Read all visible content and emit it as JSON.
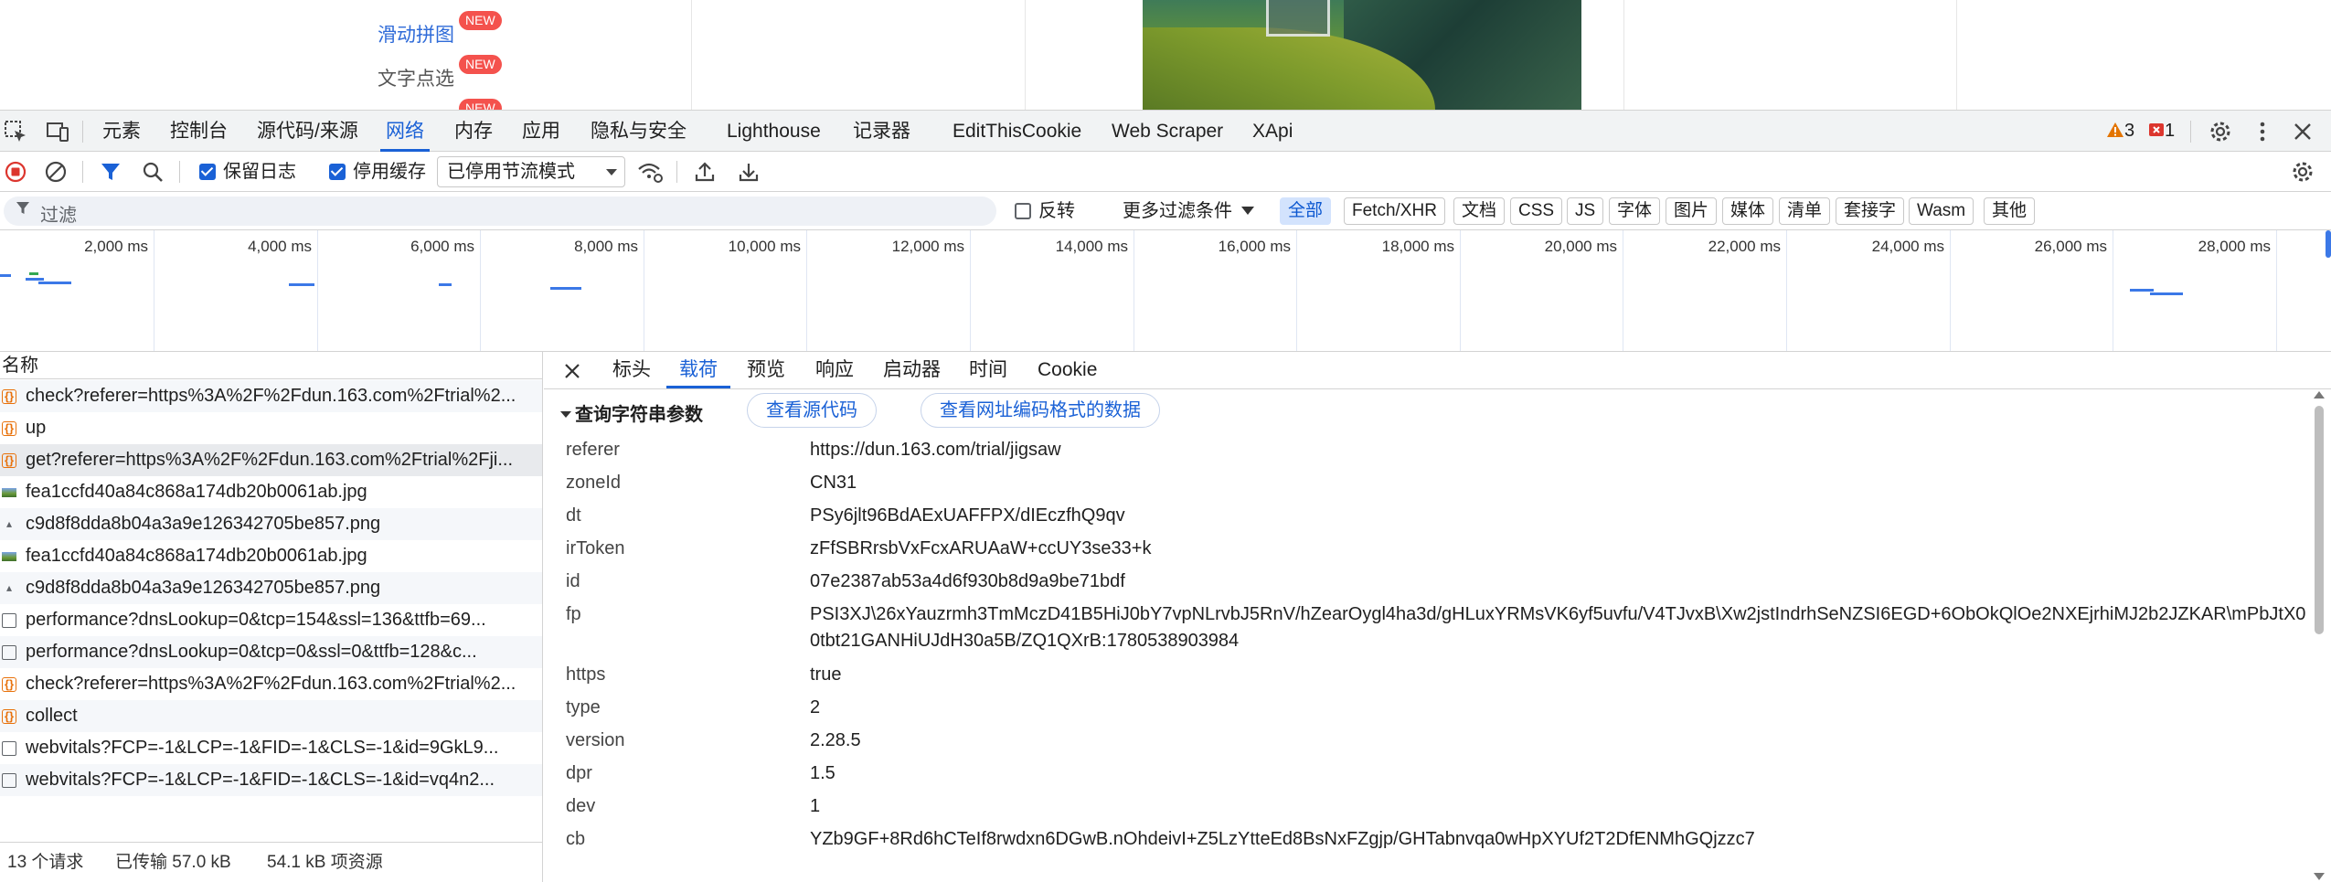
{
  "page": {
    "captcha_links": [
      {
        "label": "滑动拼图",
        "badge": "NEW"
      },
      {
        "label": "文字点选",
        "badge": "NEW"
      },
      {
        "label": "",
        "badge": "NEW"
      }
    ]
  },
  "devtools": {
    "panel_tabs": [
      "元素",
      "控制台",
      "源代码/来源",
      "网络",
      "内存",
      "应用",
      "隐私与安全",
      "Lighthouse",
      "记录器",
      "EditThisCookie",
      "Web Scraper",
      "XApi"
    ],
    "active_panel": "网络",
    "warnings": "3",
    "errors": "1",
    "toolbar": {
      "preserve_log": "保留日志",
      "disable_cache": "停用缓存",
      "throttle": "已停用节流模式"
    },
    "filter": {
      "placeholder": "过滤",
      "invert": "反转",
      "more_filters": "更多过滤条件",
      "types": [
        "全部",
        "Fetch/XHR",
        "文档",
        "CSS",
        "JS",
        "字体",
        "图片",
        "媒体",
        "清单",
        "套接字",
        "Wasm",
        "其他"
      ]
    },
    "overview_ticks": [
      "2,000 ms",
      "4,000 ms",
      "6,000 ms",
      "8,000 ms",
      "10,000 ms",
      "12,000 ms",
      "14,000 ms",
      "16,000 ms",
      "18,000 ms",
      "20,000 ms",
      "22,000 ms",
      "24,000 ms",
      "26,000 ms",
      "28,000 ms"
    ],
    "request_list": {
      "header": "名称",
      "rows": [
        {
          "type": "xhr",
          "name": "check?referer=https%3A%2F%2Fdun.163.com%2Ftrial%2..."
        },
        {
          "type": "xhr",
          "name": "up"
        },
        {
          "type": "xhr",
          "name": "get?referer=https%3A%2F%2Fdun.163.com%2Ftrial%2Fji..."
        },
        {
          "type": "img",
          "name": "fea1ccfd40a84c868a174db20b0061ab.jpg"
        },
        {
          "type": "img2",
          "name": "c9d8f8dda8b04a3a9e126342705be857.png"
        },
        {
          "type": "img",
          "name": "fea1ccfd40a84c868a174db20b0061ab.jpg"
        },
        {
          "type": "img2",
          "name": "c9d8f8dda8b04a3a9e126342705be857.png"
        },
        {
          "type": "doc",
          "name": "performance?dnsLookup=0&tcp=154&ssl=136&ttfb=69..."
        },
        {
          "type": "doc",
          "name": "performance?dnsLookup=0&tcp=0&ssl=0&ttfb=128&c..."
        },
        {
          "type": "xhr",
          "name": "check?referer=https%3A%2F%2Fdun.163.com%2Ftrial%2..."
        },
        {
          "type": "xhr",
          "name": "collect"
        },
        {
          "type": "doc",
          "name": "webvitals?FCP=-1&LCP=-1&FID=-1&CLS=-1&id=9GkL9..."
        },
        {
          "type": "doc",
          "name": "webvitals?FCP=-1&LCP=-1&FID=-1&CLS=-1&id=vq4n2..."
        }
      ],
      "status": {
        "requests": "13 个请求",
        "transferred": "已传输 57.0 kB",
        "resources": "54.1 kB 项资源"
      }
    },
    "detail": {
      "tabs": [
        "标头",
        "载荷",
        "预览",
        "响应",
        "启动器",
        "时间",
        "Cookie"
      ],
      "active_tab": "载荷",
      "section_title": "查询字符串参数",
      "view_source": "查看源代码",
      "view_url_encoded": "查看网址编码格式的数据",
      "params": [
        {
          "key": "referer",
          "value": "https://dun.163.com/trial/jigsaw"
        },
        {
          "key": "zoneId",
          "value": "CN31"
        },
        {
          "key": "dt",
          "value": "PSy6jlt96BdAExUAFFPX/dIEczfhQ9qv"
        },
        {
          "key": "irToken",
          "value": "zFfSBRrsbVxFcxARUAaW+ccUY3se33+k"
        },
        {
          "key": "id",
          "value": "07e2387ab53a4d6f930b8d9a9be71bdf"
        },
        {
          "key": "fp",
          "value": "PSI3XJ\\26xYauzrmh3TmMczD41B5HiJ0bY7vpNLrvbJ5RnV/hZearOygl4ha3d/gHLuxYRMsVK6yf5uvfu/V4TJvxB\\Xw2jstIndrhSeNZSI6EGD+6ObOkQlOe2NXEjrhiMJ2b2JZKAR\\mPbJtX00tbt21GANHiUJdH30a5B/ZQ1QXrB:1780538903984"
        },
        {
          "key": "https",
          "value": "true"
        },
        {
          "key": "type",
          "value": "2"
        },
        {
          "key": "version",
          "value": "2.28.5"
        },
        {
          "key": "dpr",
          "value": "1.5"
        },
        {
          "key": "dev",
          "value": "1"
        },
        {
          "key": "cb",
          "value": "YZb9GF+8Rd6hCTeIf8rwdxn6DGwB.nOhdeivI+Z5LzYtteEd8BsNxFZgjp/GHTabnvqa0wHpXYUf2T2DfENMhGQjzzc7"
        }
      ]
    }
  }
}
